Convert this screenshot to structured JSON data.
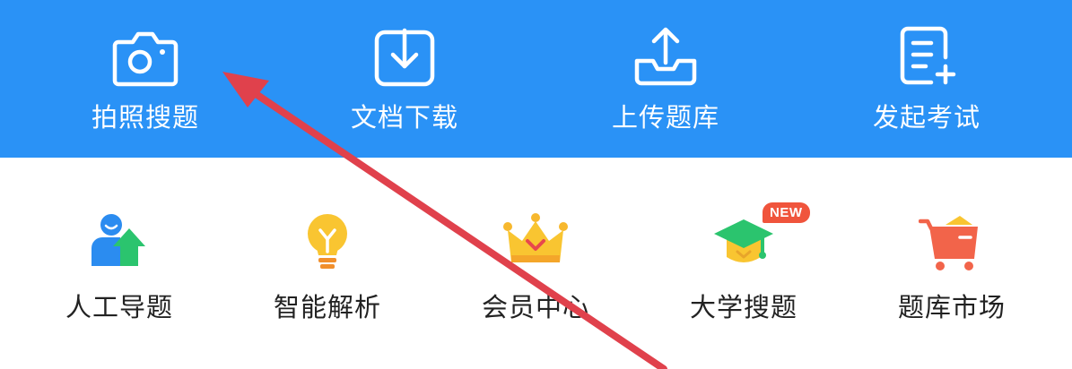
{
  "colors": {
    "top_bar": "#2a92f6",
    "badge": "#f0543c",
    "annotation_arrow": "#e0414c",
    "label_dark": "#222222"
  },
  "top_actions": [
    {
      "label": "拍照搜题",
      "icon": "camera-icon"
    },
    {
      "label": "文档下载",
      "icon": "download-icon"
    },
    {
      "label": "上传题库",
      "icon": "upload-icon"
    },
    {
      "label": "发起考试",
      "icon": "document-add-icon"
    }
  ],
  "features": [
    {
      "label": "人工导题",
      "icon": "person-upload-icon"
    },
    {
      "label": "智能解析",
      "icon": "lightbulb-icon"
    },
    {
      "label": "会员中心",
      "icon": "crown-icon"
    },
    {
      "label": "大学搜题",
      "icon": "graduation-cap-icon",
      "badge": "NEW"
    },
    {
      "label": "题库市场",
      "icon": "shopping-cart-icon"
    }
  ]
}
